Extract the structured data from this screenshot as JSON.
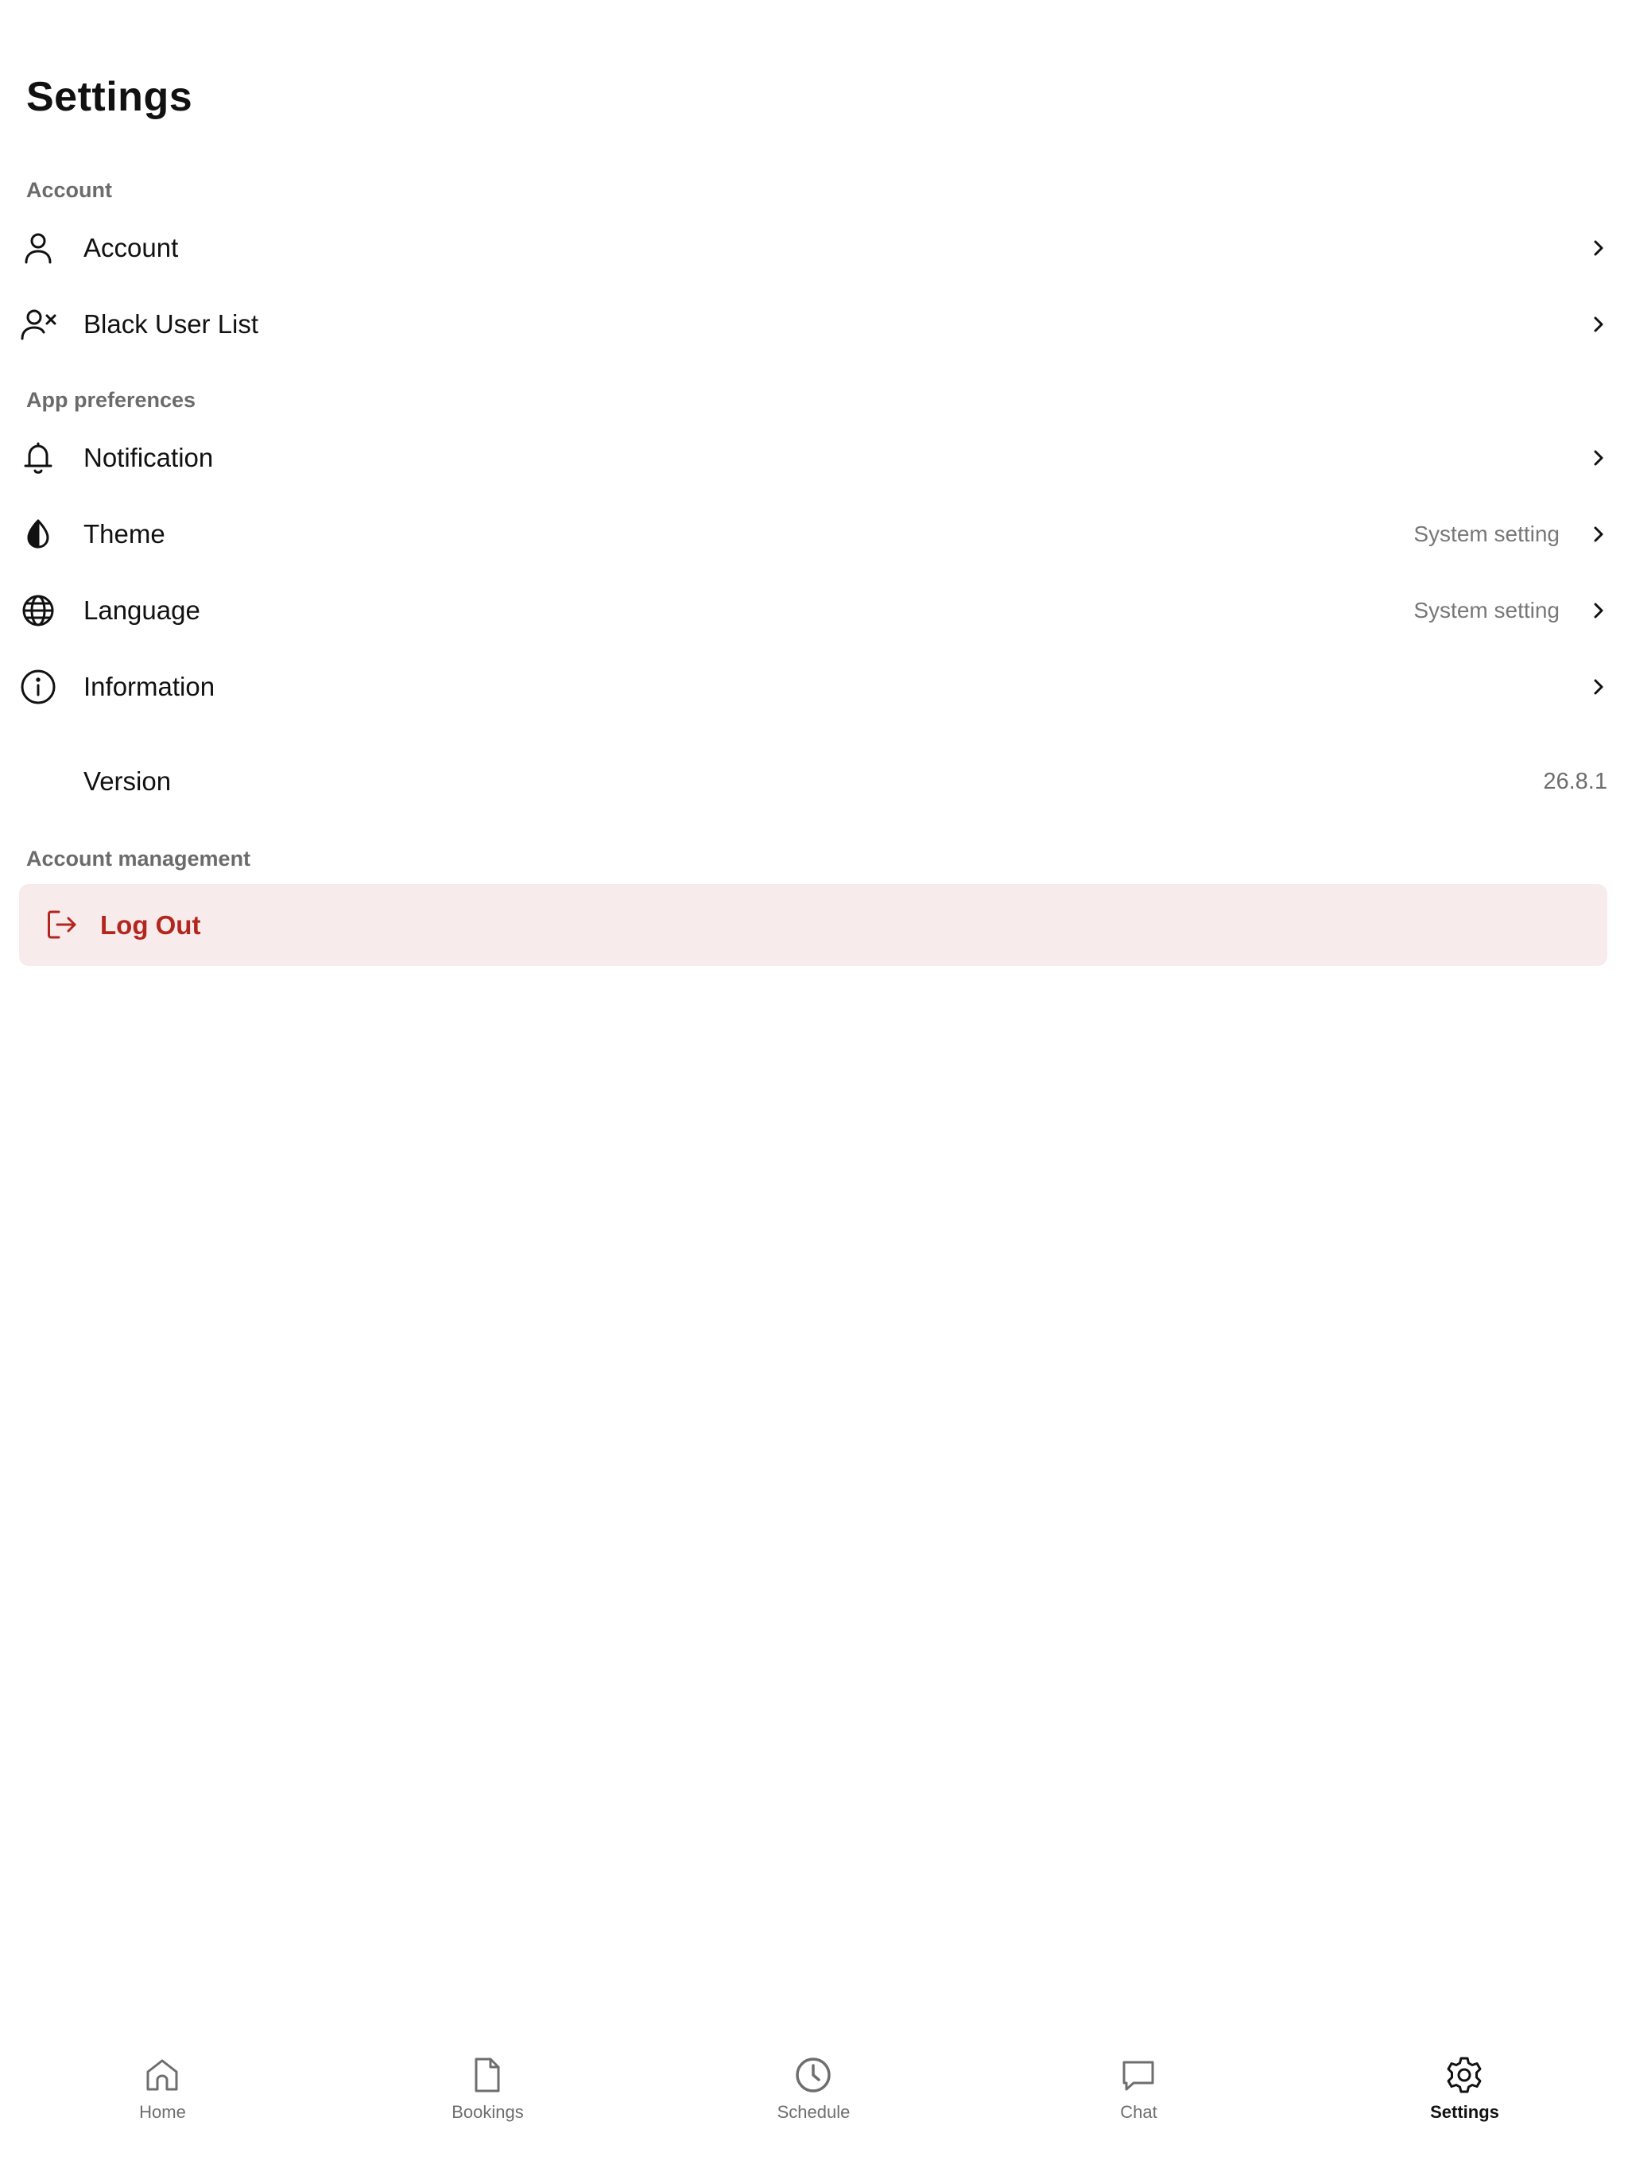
{
  "header": {
    "title": "Settings"
  },
  "sections": {
    "account": {
      "header": "Account",
      "items": [
        {
          "label": "Account",
          "icon": "person-icon"
        },
        {
          "label": "Black User List",
          "icon": "person-block-icon"
        }
      ]
    },
    "preferences": {
      "header": "App preferences",
      "items": [
        {
          "label": "Notification",
          "icon": "bell-icon"
        },
        {
          "label": "Theme",
          "icon": "contrast-icon",
          "value": "System setting"
        },
        {
          "label": "Language",
          "icon": "globe-icon",
          "value": "System setting"
        },
        {
          "label": "Information",
          "icon": "info-icon"
        }
      ]
    },
    "version": {
      "label": "Version",
      "value": "26.8.1"
    },
    "management": {
      "header": "Account management",
      "logout_label": "Log Out",
      "logout_icon": "logout-icon"
    }
  },
  "tabbar": {
    "tabs": [
      {
        "label": "Home",
        "icon": "home-icon"
      },
      {
        "label": "Bookings",
        "icon": "document-icon"
      },
      {
        "label": "Schedule",
        "icon": "clock-icon"
      },
      {
        "label": "Chat",
        "icon": "chat-icon"
      },
      {
        "label": "Settings",
        "icon": "gear-icon",
        "active": true
      }
    ]
  },
  "colors": {
    "text": "#111111",
    "secondary_text": "#6e6e6e",
    "danger": "#b3261e",
    "danger_bg": "#f8ebeb"
  }
}
